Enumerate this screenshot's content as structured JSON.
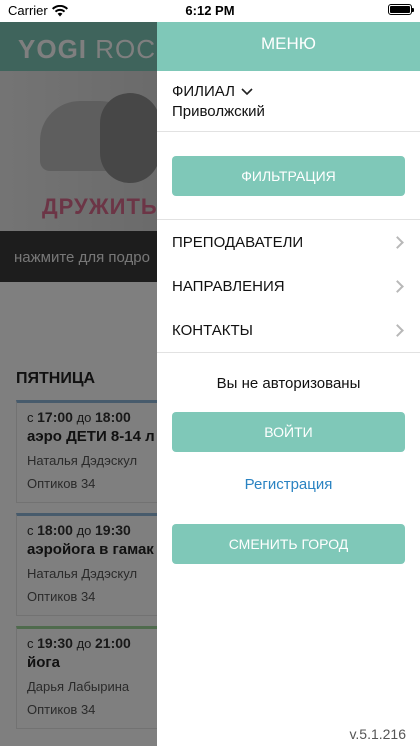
{
  "status_bar": {
    "carrier": "Carrier",
    "time": "6:12 PM"
  },
  "background": {
    "logo_bold": "YOGI",
    "logo_light": " ROC",
    "banner_title": "ДРУЖИТЬ",
    "detail_hint": "нажмите для подро",
    "day": "ПЯТНИЦА",
    "classes": [
      {
        "from_prefix": "с",
        "from": "17:00",
        "to_prefix": "до",
        "to": "18:00",
        "name": "аэро ДЕТИ 8-14 л",
        "teacher": "Наталья Дэдэскул",
        "place": "Оптиков 34"
      },
      {
        "from_prefix": "с",
        "from": "18:00",
        "to_prefix": "до",
        "to": "19:30",
        "name": "аэройога в гамак",
        "teacher": "Наталья Дэдэскул",
        "place": "Оптиков 34"
      },
      {
        "from_prefix": "с",
        "from": "19:30",
        "to_prefix": "до",
        "to": "21:00",
        "name": "йога",
        "teacher": "Дарья Лабырина",
        "place": "Оптиков 34"
      }
    ]
  },
  "menu": {
    "title": "МЕНЮ",
    "branch_label": "ФИЛИАЛ",
    "branch_value": "Приволжский",
    "filter_button": "ФИЛЬТРАЦИЯ",
    "items": [
      {
        "label": "ПРЕПОДАВАТЕЛИ"
      },
      {
        "label": "НАПРАВЛЕНИЯ"
      },
      {
        "label": "КОНТАКТЫ"
      }
    ],
    "auth_status": "Вы не авторизованы",
    "login_button": "ВОЙТИ",
    "register_link": "Регистрация",
    "change_city_button": "СМЕНИТЬ ГОРОД",
    "version": "v.5.1.216"
  },
  "colors": {
    "accent": "#7fc8b8",
    "link": "#2a83c2"
  }
}
